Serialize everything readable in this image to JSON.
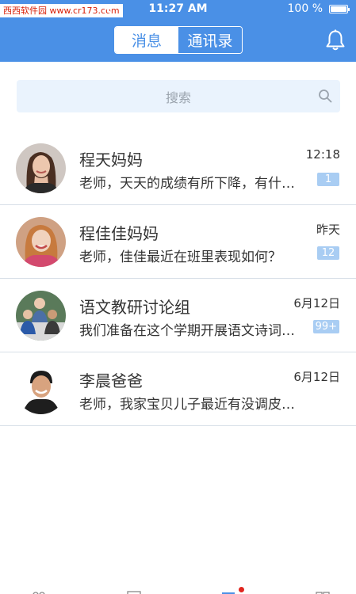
{
  "status_bar": {
    "watermark": "西西软件园 www.cr173.com",
    "time": "11:27 AM",
    "battery": "100 %"
  },
  "header": {
    "tabs": [
      {
        "label": "消息",
        "active": true
      },
      {
        "label": "通讯录",
        "active": false
      }
    ],
    "accent_color": "#4a90e6",
    "bell_icon": "bell-icon"
  },
  "search": {
    "placeholder": "搜索",
    "icon": "search-icon"
  },
  "conversations": [
    {
      "name": "程天妈妈",
      "preview": "老师，天天的成绩有所下降，有什么好的建议吗？",
      "time": "12:18",
      "badge": "1"
    },
    {
      "name": "程佳佳妈妈",
      "preview": "老师，佳佳最近在班里表现如何？",
      "time": "昨天",
      "badge": "12"
    },
    {
      "name": "语文教研讨论组",
      "preview": "我们准备在这个学期开展语文诗词大会活动",
      "time": "6月12日",
      "badge": "99+"
    },
    {
      "name": "李晨爸爸",
      "preview": "老师，我家宝贝儿子最近有没调皮捣蛋？",
      "time": "6月12日",
      "badge": ""
    }
  ],
  "tab_bar": {
    "icons": [
      "tab-home-icon",
      "tab-class-icon",
      "tab-message-icon",
      "tab-profile-icon"
    ]
  }
}
